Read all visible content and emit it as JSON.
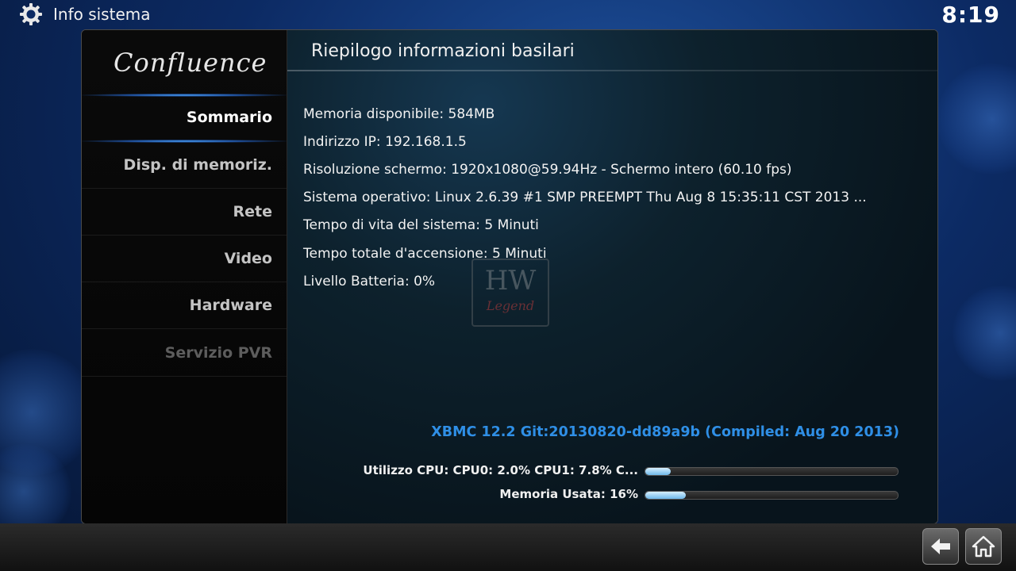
{
  "header": {
    "title": "Info sistema",
    "clock": "8:19"
  },
  "sidebar": {
    "logo": "Confluence",
    "items": [
      {
        "label": "Sommario",
        "state": "active"
      },
      {
        "label": "Disp. di memoriz.",
        "state": "normal"
      },
      {
        "label": "Rete",
        "state": "normal"
      },
      {
        "label": "Video",
        "state": "normal"
      },
      {
        "label": "Hardware",
        "state": "normal"
      },
      {
        "label": "Servizio PVR",
        "state": "disabled"
      }
    ]
  },
  "main": {
    "title": "Riepilogo informazioni basilari",
    "close_label": "×",
    "info": [
      "Memoria disponibile: 584MB",
      "Indirizzo IP: 192.168.1.5",
      "Risoluzione schermo: 1920x1080@59.94Hz - Schermo intero (60.10 fps)",
      "Sistema operativo: Linux 2.6.39 #1 SMP PREEMPT Thu Aug 8 15:35:11 CST 2013 ...",
      "Tempo di vita del sistema: 5 Minuti",
      "Tempo totale d'accensione: 5 Minuti",
      "Livello Batteria: 0%"
    ],
    "watermark": {
      "top": "HW",
      "bottom": "Legend"
    },
    "version": "XBMC 12.2 Git:20130820-dd89a9b (Compiled: Aug 20 2013)",
    "cpu": {
      "label": "Utilizzo CPU: CPU0: 2.0% CPU1: 7.8% C...",
      "fill": 0.1
    },
    "memory": {
      "label": "Memoria Usata: 16%",
      "fill": 0.16
    }
  },
  "footer": {
    "back_icon": "back-arrow-icon",
    "home_icon": "home-icon"
  },
  "colors": {
    "accent": "#2f8fe6",
    "glow": "#50aaff",
    "background": "#0c2a63"
  }
}
